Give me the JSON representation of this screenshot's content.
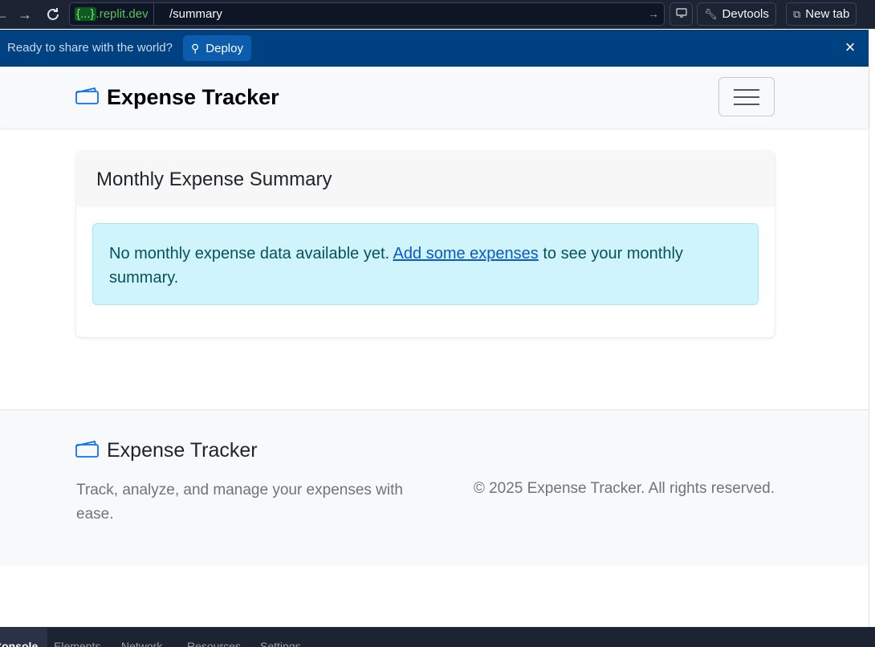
{
  "browser": {
    "host_brace": "{...}",
    "host_domain": ".replit.dev",
    "path": "/summary",
    "devtools_label": "Devtools",
    "new_tab_label": "New tab"
  },
  "banner": {
    "text": "Ready to share with the world?",
    "deploy_label": "Deploy"
  },
  "navbar": {
    "brand": "Expense Tracker"
  },
  "card": {
    "title": "Monthly Expense Summary",
    "alert_before": "No monthly expense data available yet. ",
    "alert_link": "Add some expenses",
    "alert_after": " to see your monthly summary."
  },
  "footer": {
    "brand": "Expense Tracker",
    "tagline": "Track, analyze, and manage your expenses with ease.",
    "copyright": "© 2025 Expense Tracker. All rights reserved."
  },
  "devtools": {
    "tabs": [
      "Console",
      "Elements",
      "Network",
      "Resources",
      "Settings"
    ]
  },
  "colors": {
    "banner_bg": "#004182",
    "alert_bg": "#cff4fc",
    "link": "#0a58ca",
    "wallet_icon": "#0d6efd"
  }
}
